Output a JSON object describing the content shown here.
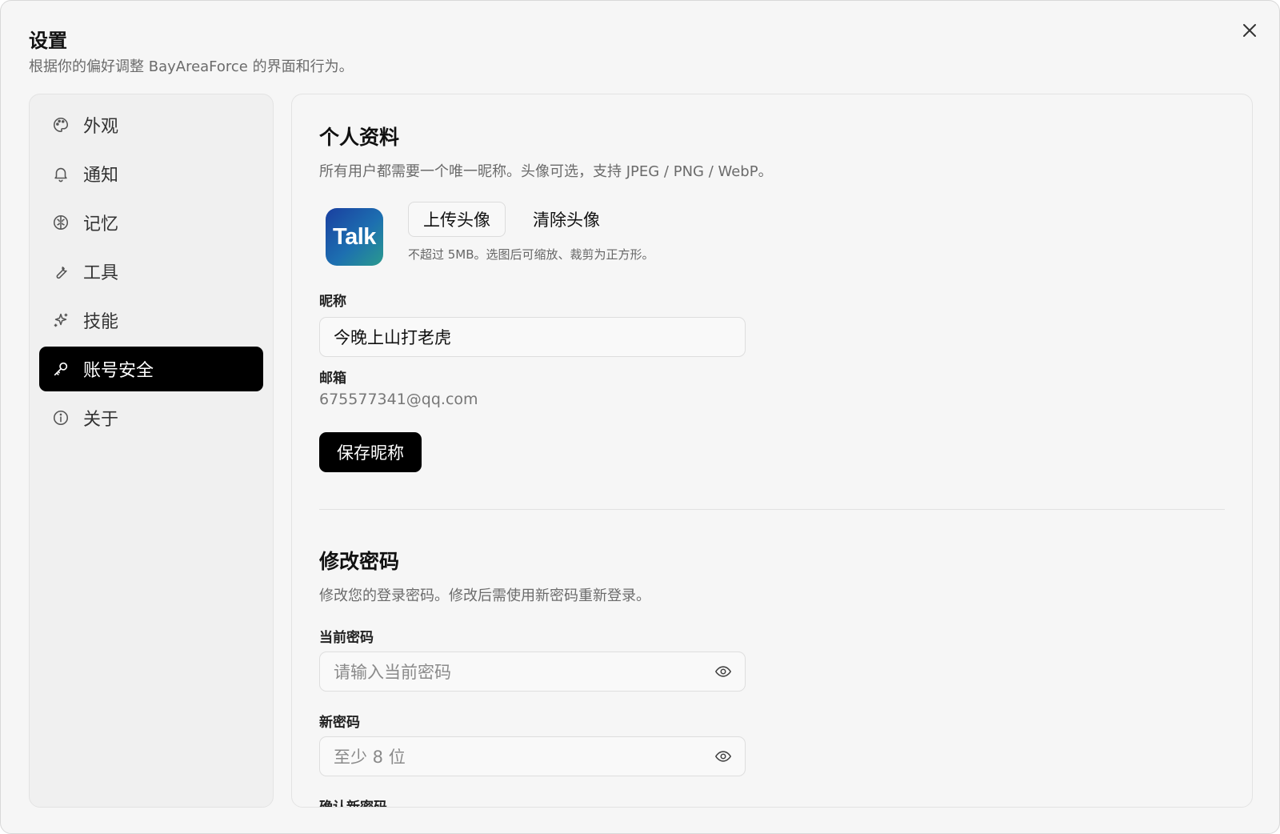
{
  "dialog": {
    "title": "设置",
    "subtitle": "根据你的偏好调整 BayAreaForce 的界面和行为。"
  },
  "sidebar": {
    "items": [
      {
        "label": "外观",
        "icon": "palette-icon",
        "active": false
      },
      {
        "label": "通知",
        "icon": "bell-icon",
        "active": false
      },
      {
        "label": "记忆",
        "icon": "brain-icon",
        "active": false
      },
      {
        "label": "工具",
        "icon": "wrench-icon",
        "active": false
      },
      {
        "label": "技能",
        "icon": "sparkles-icon",
        "active": false
      },
      {
        "label": "账号安全",
        "icon": "key-icon",
        "active": true
      },
      {
        "label": "关于",
        "icon": "info-icon",
        "active": false
      }
    ]
  },
  "profile": {
    "title": "个人资料",
    "description": "所有用户都需要一个唯一昵称。头像可选，支持 JPEG / PNG / WebP。",
    "avatar_text": "Talk",
    "upload_label": "上传头像",
    "clear_label": "清除头像",
    "avatar_hint": "不超过 5MB。选图后可缩放、裁剪为正方形。",
    "nickname_label": "昵称",
    "nickname_value": "今晚上山打老虎",
    "email_label": "邮箱",
    "email_value": "675577341@qq.com",
    "save_label": "保存昵称"
  },
  "password": {
    "title": "修改密码",
    "description": "修改您的登录密码。修改后需使用新密码重新登录。",
    "current_label": "当前密码",
    "current_placeholder": "请输入当前密码",
    "new_label": "新密码",
    "new_placeholder": "至少 8 位",
    "confirm_label": "确认新密码"
  },
  "colors": {
    "accent": "#000000",
    "background": "#f6f6f6",
    "avatar_gradient_start": "#1a3fa0",
    "avatar_gradient_end": "#2a9a8e"
  }
}
